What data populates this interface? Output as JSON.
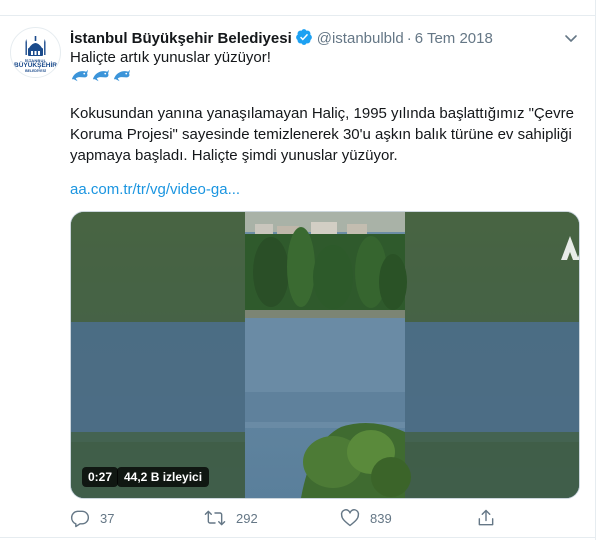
{
  "tweet": {
    "author_name": "İstanbul Büyükşehir Belediyesi",
    "handle": "@istanbulbld",
    "separator": "·",
    "date": "6 Tem 2018",
    "line1": "Haliçte artık yunuslar yüzüyor!",
    "dolphin_count": 3,
    "body_lines": [
      "Kokusundan yanına yanaşılamayan Haliç, 1995 yılında başlattığımız \"Çevre",
      "Koruma Projesi\" sayesinde temizlenerek 30'u aşkın balık türüne ev sahipliği",
      "yapmaya başladı. Haliçte şimdi yunuslar yüzüyor."
    ],
    "link": "aa.com.tr/tr/vg/video-ga..."
  },
  "avatar": {
    "line1": "İSTANBUL",
    "line2": "BÜYÜKŞEHİR",
    "line3": "BELEDİYESİ"
  },
  "media": {
    "duration": "0:27",
    "views": "44,2 B izleyici",
    "watermark": "AA"
  },
  "actions": {
    "replies": "37",
    "retweets": "292",
    "likes": "839"
  },
  "colors": {
    "accent": "#1da1f2",
    "link": "#1b95e0",
    "muted": "#657786",
    "text": "#14171a"
  }
}
